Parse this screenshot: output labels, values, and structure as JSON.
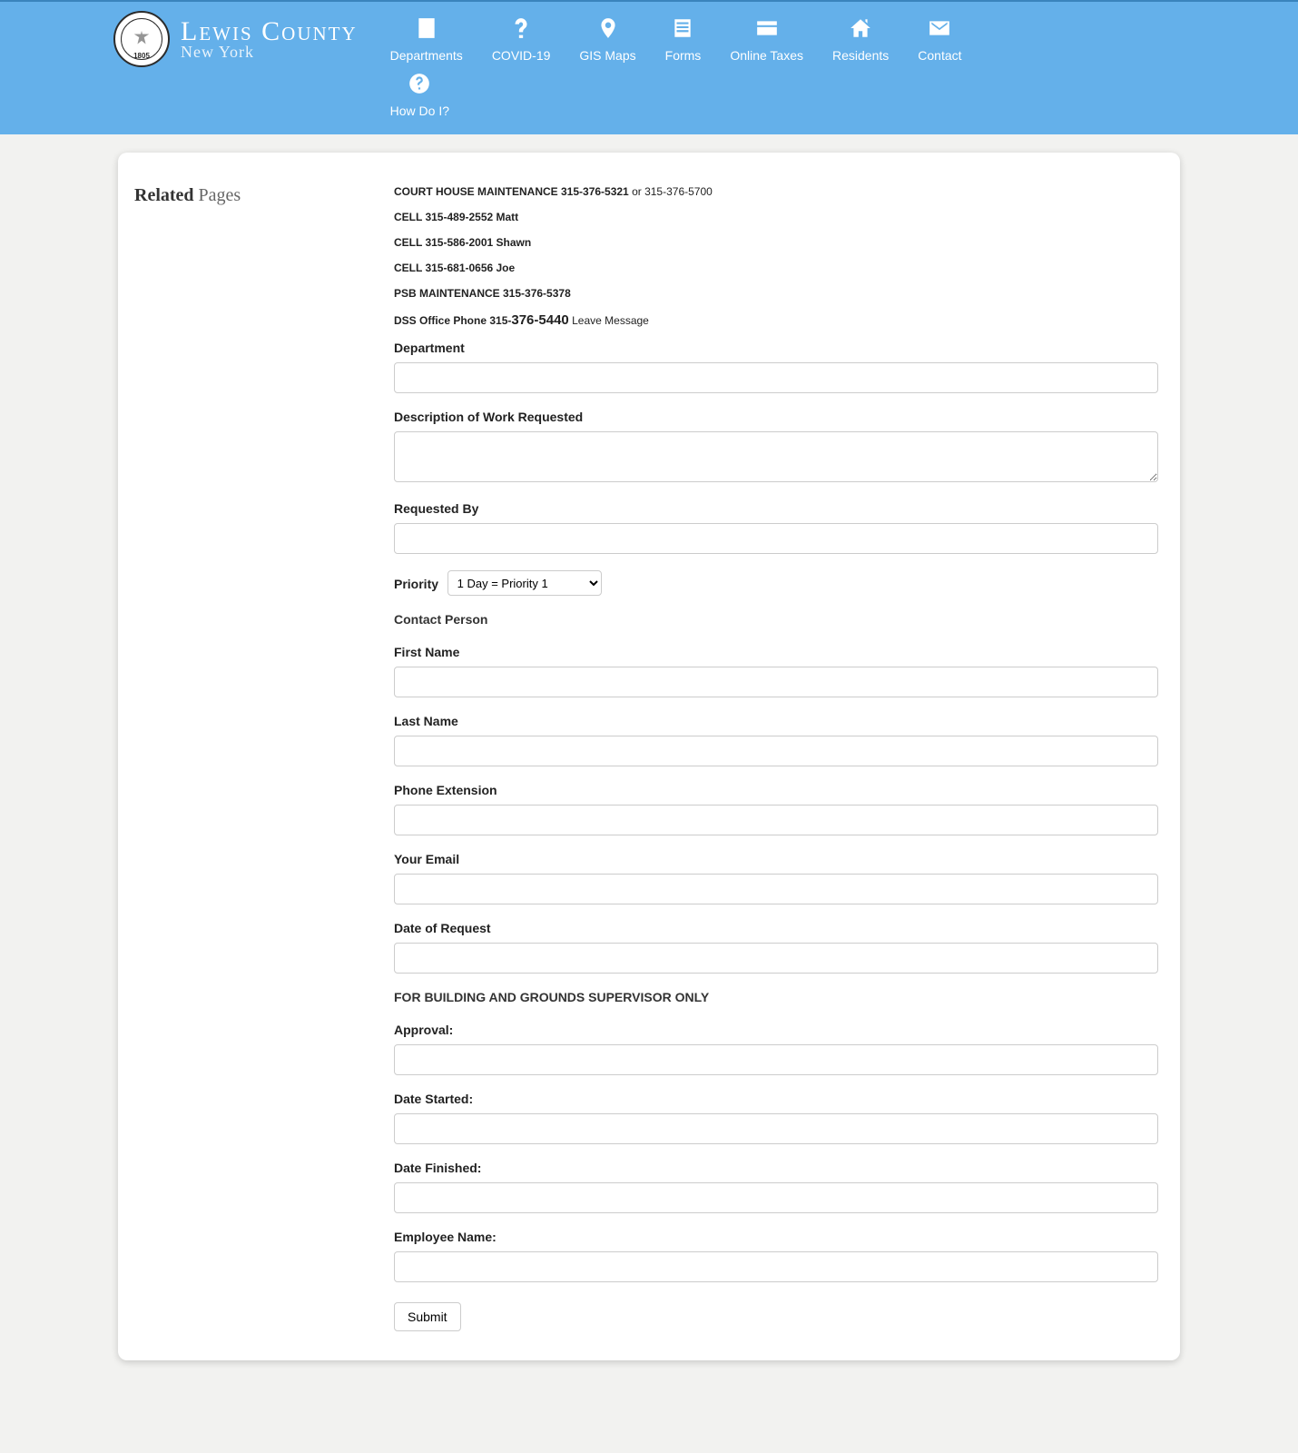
{
  "brand": {
    "title": "Lewis County",
    "subtitle": "New York",
    "seal_year": "1805"
  },
  "nav": {
    "departments": "Departments",
    "covid": "COVID-19",
    "gis": "GIS Maps",
    "forms": "Forms",
    "taxes": "Online Taxes",
    "residents": "Residents",
    "contact": "Contact",
    "howdoi": "How Do I?"
  },
  "sidebar": {
    "title_strong": "Related",
    "title_light": "Pages"
  },
  "header_info": {
    "line1_bold": "COURT HOUSE MAINTENANCE 315-376-5321",
    "line1_rest": " or 315-376-5700",
    "line2": "CELL  315-489-2552   Matt",
    "line3": "CELL  315-586-2001   Shawn",
    "line4": "CELL  315-681-0656   Joe",
    "line5": "PSB MAINTENANCE 315-376-5378",
    "line6_a": "DSS Office Phone  315-",
    "line6_b": "376-5440",
    "line6_c": "    Leave Message"
  },
  "form": {
    "department": "Department",
    "description": "Description of Work Requested",
    "requested_by": "Requested By",
    "priority_label": "Priority",
    "priority_option": "1 Day = Priority 1",
    "contact_person": "Contact Person",
    "first_name": "First Name",
    "last_name": "Last Name",
    "phone_ext": "Phone Extension",
    "your_email": "Your Email",
    "date_request": "Date of Request",
    "supervisor_only": "FOR BUILDING AND GROUNDS SUPERVISOR ONLY",
    "approval": "Approval:",
    "date_started": "Date Started:",
    "date_finished": "Date Finished:",
    "employee_name": "Employee Name:",
    "submit": "Submit"
  }
}
